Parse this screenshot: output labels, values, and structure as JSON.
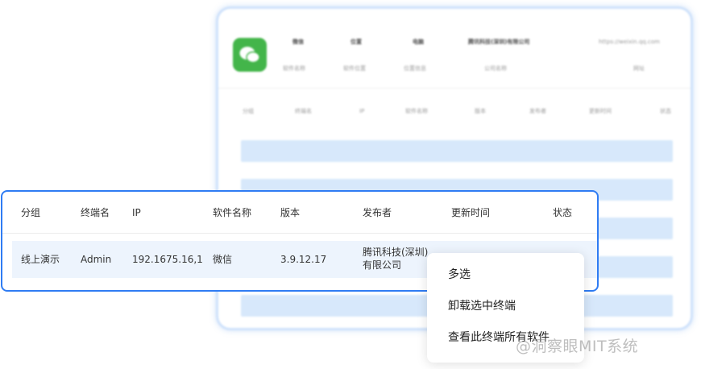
{
  "background_card": {
    "headers": [
      "微信",
      "位置",
      "电脑",
      "腾讯科技(深圳)有限公司",
      "https://weixin.qq.com"
    ],
    "subheaders": [
      "软件名称",
      "软件位置",
      "位置信息",
      "公司名称",
      "网址"
    ],
    "columns": [
      "分组",
      "终端名",
      "IP",
      "软件名称",
      "版本",
      "发布者",
      "更新时间",
      "状态"
    ],
    "logo_icon": "wechat-icon"
  },
  "table": {
    "headers": {
      "group": "分组",
      "terminal": "终端名",
      "ip": "IP",
      "software": "软件名称",
      "version": "版本",
      "publisher": "发布者",
      "updated": "更新时间",
      "status": "状态"
    },
    "row": {
      "group": "线上演示",
      "terminal": "Admin",
      "ip": "192.1675.16,1",
      "software": "微信",
      "version": "3.9.12.17",
      "publisher_line1": "腾讯科技(深圳)",
      "publisher_line2": "有限公司"
    }
  },
  "context_menu": {
    "items": [
      "多选",
      "卸载选中终端",
      "查看此终端所有软件"
    ]
  },
  "watermark": "@洞察眼MIT系统",
  "colors": {
    "accent_border": "#2f7cf3",
    "row_highlight": "#edf4fd",
    "bg_bar": "#d7e8fb",
    "wechat_green": "#43b54a"
  }
}
